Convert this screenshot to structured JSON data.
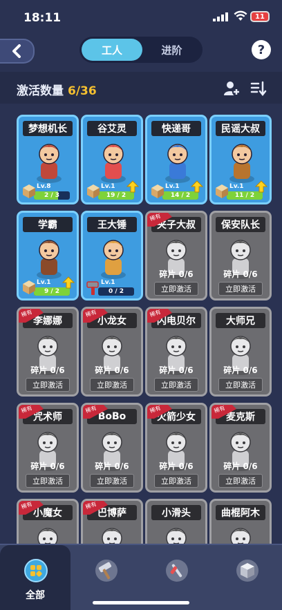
{
  "status": {
    "time": "18:11",
    "battery": "11"
  },
  "header": {
    "tabs": [
      {
        "label": "工人",
        "active": true
      },
      {
        "label": "进阶",
        "active": false
      }
    ],
    "help_label": "?"
  },
  "activation": {
    "label": "激活数量",
    "count": "6/36"
  },
  "ribbon_label": "稀有",
  "activate_label": "立即激活",
  "cards": [
    {
      "name": "梦想机长",
      "active": true,
      "level": "Lv.8",
      "fragments": "2 / 3",
      "progress": 0.67,
      "upgradable": false
    },
    {
      "name": "谷艾灵",
      "active": true,
      "level": "Lv.1",
      "fragments": "19 / 2",
      "progress": 1.0,
      "upgradable": true
    },
    {
      "name": "快递哥",
      "active": true,
      "level": "Lv.1",
      "fragments": "14 / 2",
      "progress": 1.0,
      "upgradable": true
    },
    {
      "name": "民谣大叔",
      "active": true,
      "level": "Lv.1",
      "fragments": "11 / 2",
      "progress": 1.0,
      "upgradable": true
    },
    {
      "name": "学霸",
      "active": true,
      "level": "Lv.1",
      "fragments": "9 / 2",
      "progress": 1.0,
      "upgradable": true
    },
    {
      "name": "王大锤",
      "active": true,
      "level": "Lv.1",
      "fragments": "0 / 2",
      "progress": 0.0,
      "upgradable": false,
      "hammer": true
    },
    {
      "name": "夹子大叔",
      "active": false,
      "rare": true,
      "fragments": "碎片 0/6"
    },
    {
      "name": "保安队长",
      "active": false,
      "rare": false,
      "fragments": "碎片 0/6"
    },
    {
      "name": "李娜娜",
      "active": false,
      "rare": true,
      "fragments": "碎片 0/6"
    },
    {
      "name": "小龙女",
      "active": false,
      "rare": true,
      "fragments": "碎片 0/6"
    },
    {
      "name": "闪电贝尔",
      "active": false,
      "rare": true,
      "fragments": "碎片 0/6"
    },
    {
      "name": "大师兄",
      "active": false,
      "rare": false,
      "fragments": "碎片 0/6"
    },
    {
      "name": "咒术师",
      "active": false,
      "rare": true,
      "fragments": "碎片 0/6"
    },
    {
      "name": "BoBo",
      "active": false,
      "rare": true,
      "fragments": "碎片 0/6"
    },
    {
      "name": "火箭少女",
      "active": false,
      "rare": true,
      "fragments": "碎片 0/6"
    },
    {
      "name": "麦克斯",
      "active": false,
      "rare": true,
      "fragments": "碎片 0/6"
    },
    {
      "name": "小魔女",
      "active": false,
      "rare": true,
      "fragments": ""
    },
    {
      "name": "巴博萨",
      "active": false,
      "rare": true,
      "fragments": ""
    },
    {
      "name": "小滑头",
      "active": false,
      "rare": false,
      "fragments": ""
    },
    {
      "name": "曲棍阿木",
      "active": false,
      "rare": false,
      "fragments": ""
    }
  ],
  "bottom_nav": [
    {
      "label": "全部",
      "icon": "grid-icon",
      "active": true
    },
    {
      "label": "",
      "icon": "hammer-icon",
      "active": false
    },
    {
      "label": "",
      "icon": "wrench-icon",
      "active": false
    },
    {
      "label": "",
      "icon": "cube-icon",
      "active": false
    }
  ]
}
